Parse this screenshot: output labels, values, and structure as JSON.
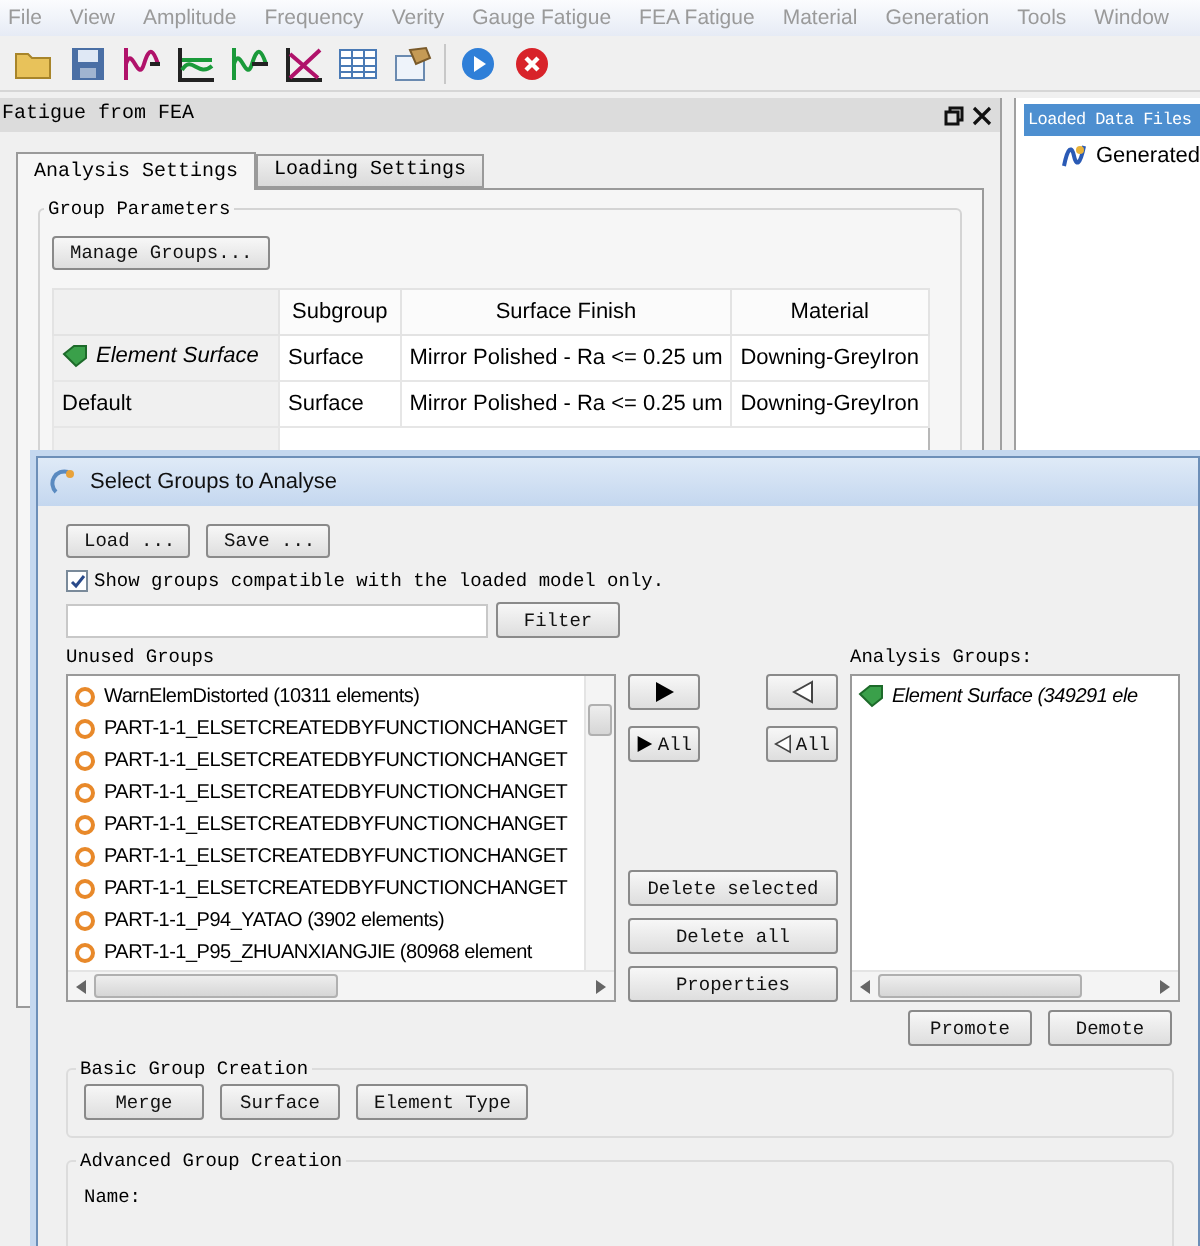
{
  "menu": [
    {
      "label": "File"
    },
    {
      "label": "View"
    },
    {
      "label": "Amplitude"
    },
    {
      "label": "Frequency"
    },
    {
      "label": "Verity"
    },
    {
      "label": "Gauge Fatigue"
    },
    {
      "label": "FEA Fatigue"
    },
    {
      "label": "Material"
    },
    {
      "label": "Generation"
    },
    {
      "label": "Tools"
    },
    {
      "label": "Window"
    }
  ],
  "toolbar": [
    {
      "kind": "open"
    },
    {
      "kind": "save"
    },
    {
      "kind": "signal"
    },
    {
      "kind": "spectrum"
    },
    {
      "kind": "signal2"
    },
    {
      "kind": "xy"
    },
    {
      "kind": "table"
    },
    {
      "kind": "properties"
    },
    {
      "kind": "sep"
    },
    {
      "kind": "run"
    },
    {
      "kind": "stop"
    }
  ],
  "panel": {
    "title": "Fatigue from FEA",
    "tabs": [
      {
        "label": "Analysis Settings",
        "selected": true
      },
      {
        "label": "Loading Settings",
        "selected": false
      }
    ],
    "group_box": {
      "title": "Group Parameters",
      "button": "Manage Groups...",
      "table": {
        "columns": [
          "",
          "Subgroup",
          "Surface Finish",
          "Material"
        ],
        "rows": [
          {
            "kind": "surface",
            "group": "Element Surface",
            "subgroup": "Surface",
            "finish": "Mirror Polished - Ra <= 0.25 um",
            "material": "Downing-GreyIron"
          },
          {
            "kind": "plain",
            "group": "Default",
            "subgroup": "Surface",
            "finish": "Mirror Polished - Ra <= 0.25 um",
            "material": "Downing-GreyIron"
          }
        ]
      }
    }
  },
  "side_panel": {
    "title": "Loaded Data Files",
    "items": [
      {
        "label": "Generated"
      }
    ]
  },
  "dialog": {
    "title": "Select Groups to Analyse",
    "load_button": "Load ...",
    "save_button": "Save ...",
    "compatible_only": {
      "label": "Show groups compatible with the loaded model only.",
      "checked": true
    },
    "filter_button": "Filter",
    "unused_label": "Unused Groups",
    "unused_groups": [
      {
        "label": "WarnElemDistorted (10311 elements)"
      },
      {
        "label": "PART-1-1_ELSETCREATEDBYFUNCTIONCHANGET"
      },
      {
        "label": "PART-1-1_ELSETCREATEDBYFUNCTIONCHANGET"
      },
      {
        "label": "PART-1-1_ELSETCREATEDBYFUNCTIONCHANGET"
      },
      {
        "label": "PART-1-1_ELSETCREATEDBYFUNCTIONCHANGET"
      },
      {
        "label": "PART-1-1_ELSETCREATEDBYFUNCTIONCHANGET"
      },
      {
        "label": "PART-1-1_ELSETCREATEDBYFUNCTIONCHANGET"
      },
      {
        "label": "PART-1-1_P94_YATAO (3902 elements)"
      },
      {
        "label": "PART-1-1_P95_ZHUANXIANGJIE (80968 element"
      }
    ],
    "add_all": "All",
    "remove_all": "All",
    "actions": [
      "Delete selected",
      "Delete all",
      "Properties"
    ],
    "analysis_label": "Analysis Groups:",
    "analysis_groups": [
      {
        "label": "Element Surface (349291 ele"
      }
    ],
    "promote": "Promote",
    "demote": "Demote",
    "basic": {
      "title": "Basic Group Creation",
      "buttons": [
        "Merge",
        "Surface",
        "Element Type"
      ]
    },
    "advanced": {
      "title": "Advanced Group Creation",
      "name_label": "Name:"
    }
  }
}
